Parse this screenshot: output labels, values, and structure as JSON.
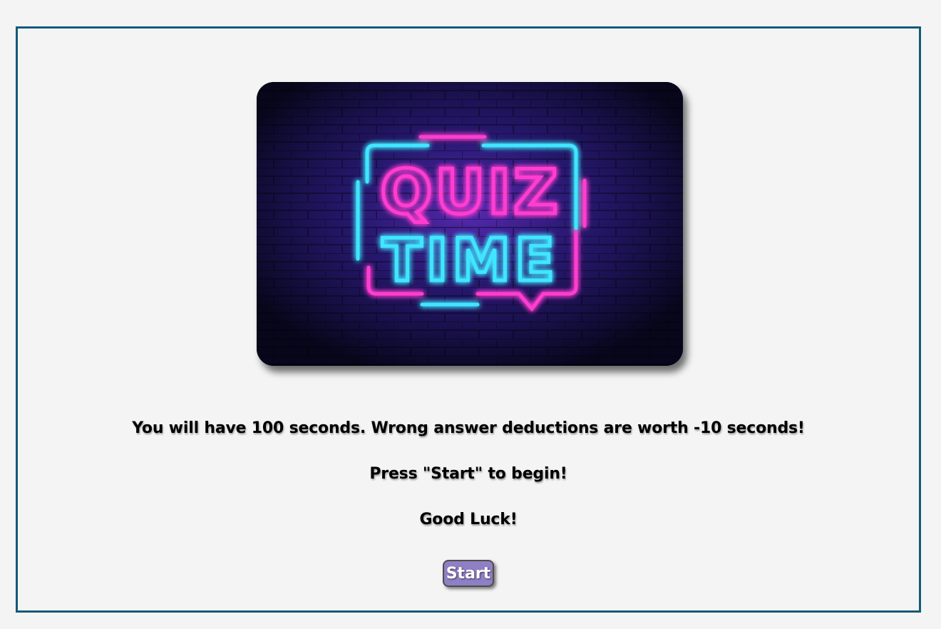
{
  "banner": {
    "line1": "QUIZ",
    "line2": "TIME"
  },
  "messages": {
    "rules": "You will have 100 seconds. Wrong answer deductions are worth -10 seconds!",
    "prompt": "Press \"Start\" to begin!",
    "luck": "Good Luck!"
  },
  "start_button": {
    "label": "Start"
  },
  "colors": {
    "frame_border": "#125a78",
    "button_bg": "#8f7fc4",
    "neon_pink": "#ff3cd0",
    "neon_cyan": "#3fe6ff",
    "brick_bg": "#0e0c2b"
  }
}
